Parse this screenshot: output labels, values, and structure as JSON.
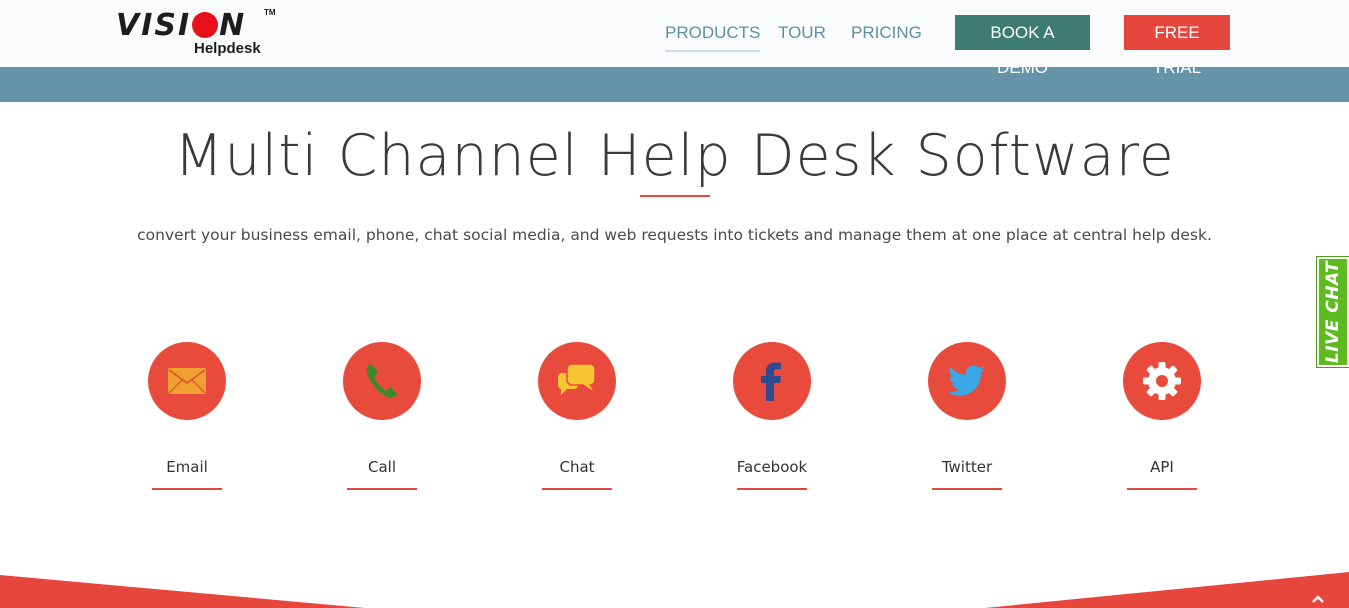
{
  "brand": {
    "logo_word_a": "VISI",
    "logo_word_b": "N",
    "logo_tm": "TM",
    "logo_sub": "Helpdesk"
  },
  "nav": {
    "products": "PRODUCTS",
    "tour": "TOUR",
    "pricing": "PRICING",
    "book_demo": "BOOK A DEMO",
    "free_trial": "FREE TRIAL"
  },
  "hero": {
    "title": "Multi Channel Help Desk Software",
    "subtitle": "convert your business email, phone, chat social media, and web requests into tickets and manage them at one place at central help desk."
  },
  "channels": [
    {
      "label": "Email",
      "icon": "envelope-icon"
    },
    {
      "label": "Call",
      "icon": "phone-icon"
    },
    {
      "label": "Chat",
      "icon": "chat-bubbles-icon"
    },
    {
      "label": "Facebook",
      "icon": "facebook-icon"
    },
    {
      "label": "Twitter",
      "icon": "twitter-icon"
    },
    {
      "label": "API",
      "icon": "gear-icon"
    }
  ],
  "live_chat": "LIVE CHAT",
  "colors": {
    "accent_red": "#e84b3b",
    "nav_blue": "#5f8fa6",
    "band_blue": "#6593a7",
    "demo_green": "#3e7c71",
    "live_chat_green": "#5dbb1f",
    "email_icon": "#f0a030",
    "call_icon": "#3b8a2a",
    "chat_icon": "#f7c531",
    "facebook_icon": "#2f4a8f",
    "twitter_icon": "#3ba7e6"
  }
}
